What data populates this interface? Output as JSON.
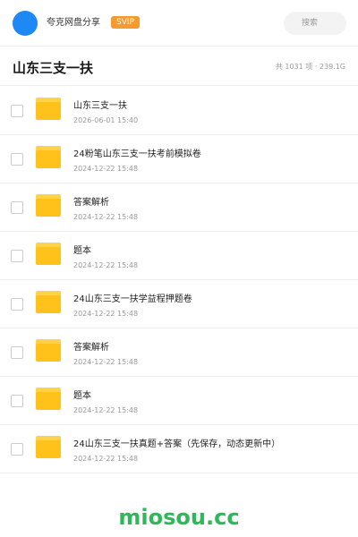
{
  "header": {
    "share_title": "夸克网盘分享",
    "badge": "SVIP",
    "search_placeholder": "搜索"
  },
  "folder": {
    "title": "山东三支一扶",
    "meta": "共 1031 项 · 239.1G"
  },
  "items": [
    {
      "name": "山东三支一扶",
      "date": "2026-06-01 15:40"
    },
    {
      "name": "24粉笔山东三支一扶考前模拟卷",
      "date": "2024-12-22 15:48"
    },
    {
      "name": "答案解析",
      "date": "2024-12-22 15:48"
    },
    {
      "name": "题本",
      "date": "2024-12-22 15:48"
    },
    {
      "name": "24山东三支一扶学益程押题卷",
      "date": "2024-12-22 15:48"
    },
    {
      "name": "答案解析",
      "date": "2024-12-22 15:48"
    },
    {
      "name": "题本",
      "date": "2024-12-22 15:48"
    },
    {
      "name": "24山东三支一扶真题+答案（先保存，动态更新中）",
      "date": "2024-12-22 15:48"
    }
  ],
  "watermark": "miosou.cc",
  "colors": {
    "accent_blue": "#1e88f5",
    "svip_orange": "#f79a2e",
    "folder_yellow": "#ffc21a",
    "watermark_green": "#2fb85a"
  }
}
